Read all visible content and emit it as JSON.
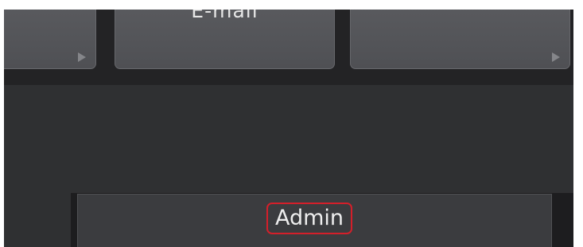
{
  "menu": {
    "tiles": [
      {
        "label": "",
        "has_arrow": true
      },
      {
        "label": "E-mail",
        "has_arrow": false
      },
      {
        "label": "",
        "has_arrow": true
      }
    ]
  },
  "admin": {
    "label": "Admin",
    "highlight_color": "#d41f2a"
  },
  "colors": {
    "background": "#2f3032",
    "tile": "#55565a",
    "text": "#e6e6e6"
  },
  "icons": [
    "chevron-right-icon",
    "chevron-right-icon"
  ]
}
